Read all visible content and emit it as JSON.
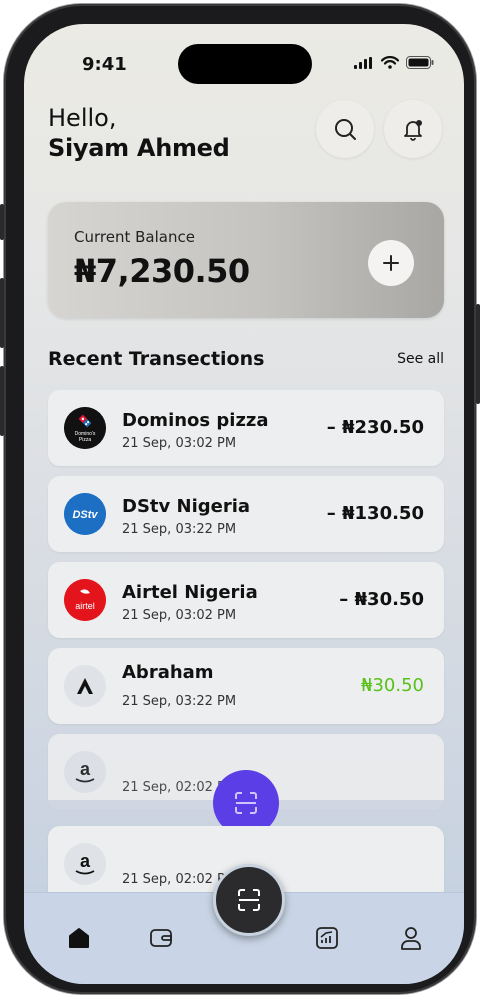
{
  "status": {
    "time": "9:41"
  },
  "header": {
    "greeting": "Hello,",
    "user_name": "Siyam Ahmed"
  },
  "icons": {
    "search": "search-icon",
    "notification": "bell-icon",
    "add": "plus-icon",
    "scan": "scan-icon",
    "home": "home-icon",
    "wallet": "wallet-icon",
    "stats": "chart-icon",
    "profile": "user-icon"
  },
  "balance": {
    "label": "Current Balance",
    "amount": "₦7,230.50"
  },
  "transactions_section": {
    "title": "Recent Transections",
    "see_all": "See all"
  },
  "transactions": [
    {
      "name": "Dominos pizza",
      "date": "21 Sep, 03:02 PM",
      "amount": "– ₦230.50",
      "type": "debit",
      "logo_text": "Domino's Pizza",
      "logo_color": "#1a1a1a"
    },
    {
      "name": "DStv Nigeria",
      "date": "21 Sep, 03:22 PM",
      "amount": "– ₦130.50",
      "type": "debit",
      "logo_text": "DStv",
      "logo_color": "#1d6fc4"
    },
    {
      "name": "Airtel Nigeria",
      "date": "21 Sep, 03:02 PM",
      "amount": "– ₦30.50",
      "type": "debit",
      "logo_text": "airtel",
      "logo_color": "#e3141c"
    },
    {
      "name": "Abraham",
      "date": "21 Sep, 03:22 PM",
      "amount": "₦30.50",
      "type": "credit",
      "logo_text": "A",
      "logo_color": "#e0e2e6"
    },
    {
      "name": "",
      "date": "21 Sep, 02:02 PM",
      "amount": "",
      "type": "debit",
      "logo_text": "a",
      "logo_color": "#e0e2e6"
    },
    {
      "name": "",
      "date": "21 Sep, 02:02 PM",
      "amount": "",
      "type": "debit",
      "logo_text": "a",
      "logo_color": "#e0e2e6"
    }
  ],
  "colors": {
    "credit": "#59c21a",
    "scan_button": "#2b2b2d",
    "accent_purple": "#5b3ee6"
  }
}
